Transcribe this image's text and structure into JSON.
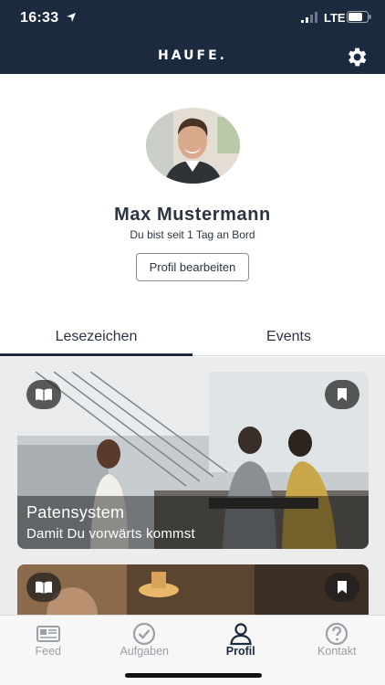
{
  "status_bar": {
    "time": "16:33",
    "network": "LTE"
  },
  "header": {
    "logo": "HAUFE.",
    "settings_icon": "gear-icon"
  },
  "profile": {
    "name": "Max  Mustermann",
    "since": "Du bist seit 1 Tag an Bord",
    "edit_label": "Profil bearbeiten"
  },
  "tabs": [
    {
      "label": "Lesezeichen",
      "active": true
    },
    {
      "label": "Events",
      "active": false
    }
  ],
  "cards": [
    {
      "title": "Patensystem",
      "subtitle": "Damit Du vorwärts kommst",
      "left_icon": "book-icon",
      "right_icon": "bookmark-icon"
    },
    {
      "title": "",
      "subtitle": "",
      "left_icon": "book-icon",
      "right_icon": "bookmark-icon"
    }
  ],
  "nav": [
    {
      "label": "Feed",
      "icon": "newspaper-icon",
      "active": false
    },
    {
      "label": "Aufgaben",
      "icon": "check-circle-icon",
      "active": false
    },
    {
      "label": "Profil",
      "icon": "user-icon",
      "active": true
    },
    {
      "label": "Kontakt",
      "icon": "help-circle-icon",
      "active": false
    }
  ],
  "colors": {
    "header": "#1b2a3e",
    "accent": "#1b2a3e",
    "inactive": "#9aa0a6"
  }
}
